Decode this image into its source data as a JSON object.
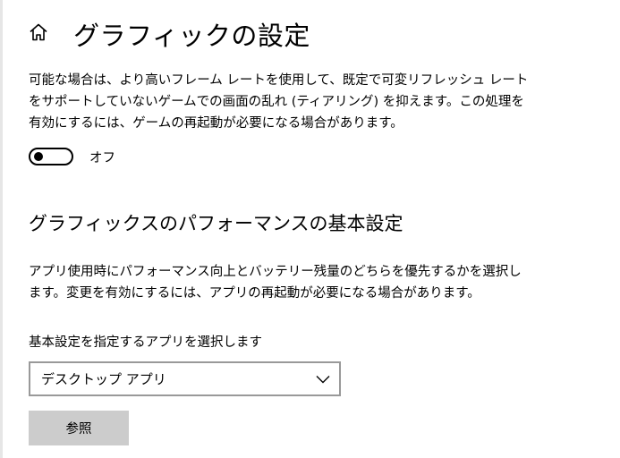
{
  "page": {
    "title": "グラフィックの設定"
  },
  "icons": {
    "home": "home-icon",
    "dropdown": "chevron-down-icon"
  },
  "vrr": {
    "description": "可能な場合は、より高いフレーム レートを使用して、既定で可変リフレッシュ レートをサポートしていないゲームでの画面の乱れ (ティアリング) を抑えます。この処理を有効にするには、ゲームの再起動が必要になる場合があります。",
    "toggle_state": "オフ",
    "toggle_on": false
  },
  "performance": {
    "section_title": "グラフィックスのパフォーマンスの基本設定",
    "description": "アプリ使用時にパフォーマンス向上とバッテリー残量のどちらを優先するかを選択します。変更を有効にするには、アプリの再起動が必要になる場合があります。",
    "select_label": "基本設定を指定するアプリを選択します",
    "selected_app": "デスクトップ アプリ",
    "browse_label": "参照"
  },
  "colors": {
    "button_bg": "#cccccc",
    "dropdown_border": "#999999",
    "text": "#000000"
  }
}
